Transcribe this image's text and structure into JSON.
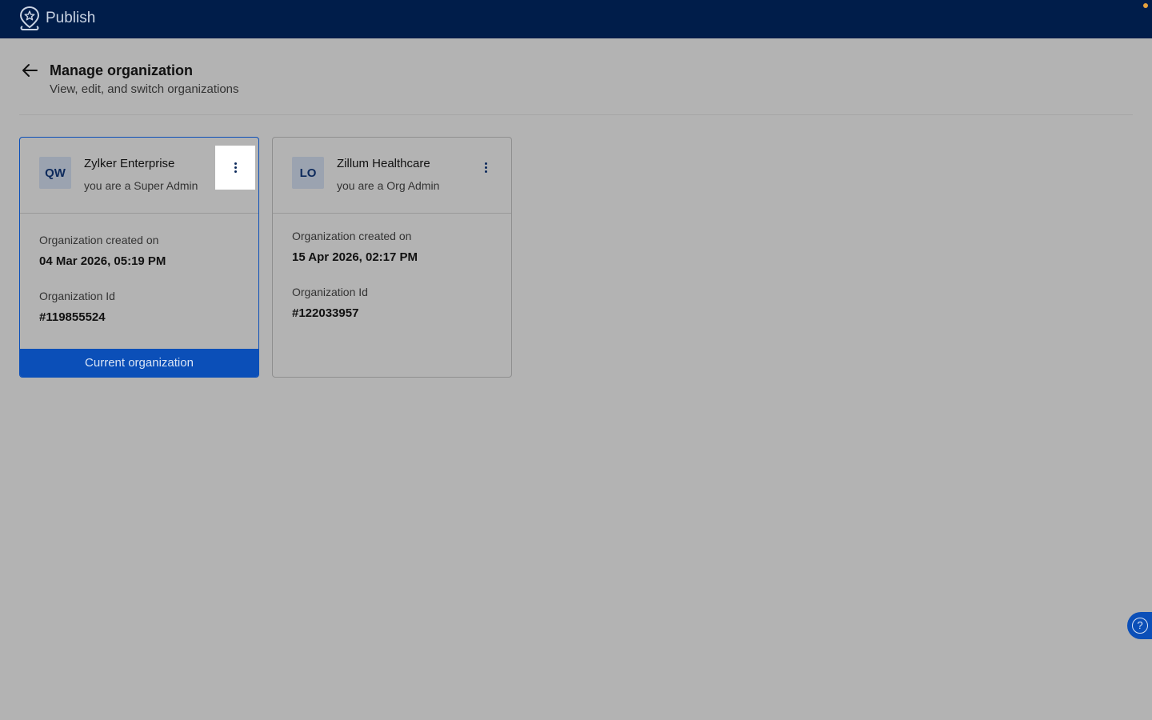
{
  "app": {
    "title": "Publish",
    "logo_icon": "location-star-icon"
  },
  "header": {
    "title": "Manage organization",
    "subtitle": "View, edit, and switch organizations",
    "back_icon": "arrow-left-icon"
  },
  "organizations": [
    {
      "initials": "QW",
      "name": "Zylker Enterprise",
      "role": "you are a Super Admin",
      "created_label": "Organization created on",
      "created_value": "04 Mar 2026, 05:19 PM",
      "id_label": "Organization Id",
      "id_value": "#119855524",
      "current_label": "Current organization",
      "is_current": true
    },
    {
      "initials": "LO",
      "name": "Zillum Healthcare",
      "role": "you are a Org Admin",
      "created_label": "Organization created on",
      "created_value": "15 Apr 2026, 02:17 PM",
      "id_label": "Organization Id",
      "id_value": "#122033957",
      "is_current": false
    }
  ],
  "help": {
    "glyph": "?",
    "icon": "help-icon"
  },
  "colors": {
    "topbar": "#001d4a",
    "accent": "#0b4fb8",
    "overlay_bg": "#b3b3b3"
  }
}
